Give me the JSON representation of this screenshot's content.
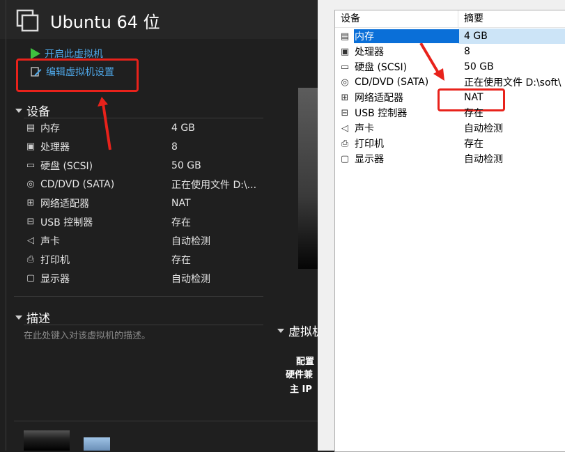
{
  "window": {
    "title": "Ubuntu 64 位"
  },
  "actions": {
    "power_on": "开启此虚拟机",
    "edit_settings": "编辑虚拟机设置"
  },
  "sections": {
    "devices": "设备",
    "description": "描述",
    "vm_details": "虚拟机"
  },
  "description": {
    "placeholder": "在此处键入对该虚拟机的描述。"
  },
  "devices": [
    {
      "icon": "memory-icon",
      "name": "内存",
      "value": "4 GB"
    },
    {
      "icon": "processor-icon",
      "name": "处理器",
      "value": "8"
    },
    {
      "icon": "hard-disk-icon",
      "name": "硬盘 (SCSI)",
      "value": "50 GB"
    },
    {
      "icon": "cd-dvd-icon",
      "name": "CD/DVD (SATA)",
      "value": "正在使用文件 D:\\..."
    },
    {
      "icon": "network-adapter-icon",
      "name": "网络适配器",
      "value": "NAT"
    },
    {
      "icon": "usb-icon",
      "name": "USB 控制器",
      "value": "存在"
    },
    {
      "icon": "sound-card-icon",
      "name": "声卡",
      "value": "自动检测"
    },
    {
      "icon": "printer-icon",
      "name": "打印机",
      "value": "存在"
    },
    {
      "icon": "display-icon",
      "name": "显示器",
      "value": "自动检测"
    }
  ],
  "vm_details": {
    "config_label": "配置",
    "hw_compat_label": "硬件兼",
    "ip_label": "主 IP"
  },
  "settings": {
    "columns": {
      "device": "设备",
      "summary": "摘要"
    },
    "rows": [
      {
        "icon": "memory-icon",
        "name": "内存",
        "value": "4 GB",
        "selected": true
      },
      {
        "icon": "processor-icon",
        "name": "处理器",
        "value": "8"
      },
      {
        "icon": "hard-disk-icon",
        "name": "硬盘 (SCSI)",
        "value": "50 GB"
      },
      {
        "icon": "cd-dvd-icon",
        "name": "CD/DVD (SATA)",
        "value": "正在使用文件 D:\\soft\\"
      },
      {
        "icon": "network-adapter-icon",
        "name": "网络适配器",
        "value": "NAT"
      },
      {
        "icon": "usb-icon",
        "name": "USB 控制器",
        "value": "存在"
      },
      {
        "icon": "sound-card-icon",
        "name": "声卡",
        "value": "自动检测"
      },
      {
        "icon": "printer-icon",
        "name": "打印机",
        "value": "存在"
      },
      {
        "icon": "display-icon",
        "name": "显示器",
        "value": "自动检测"
      }
    ]
  },
  "colors": {
    "annotation": "#e8221b",
    "link": "#4ea6e6",
    "selection": "#0a6fd8"
  }
}
